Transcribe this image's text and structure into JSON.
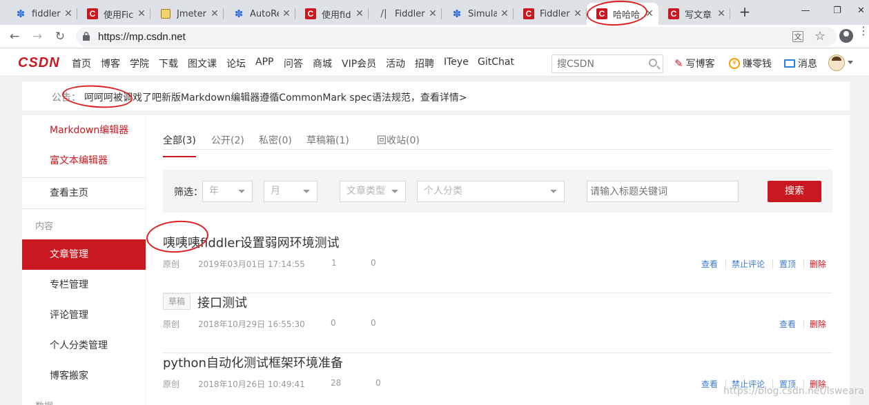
{
  "browser": {
    "tabs": [
      {
        "title": "fiddler",
        "icon": "paw-icon"
      },
      {
        "title": "使用Fic",
        "icon": "csdn-icon"
      },
      {
        "title": "Jmeter",
        "icon": "notepad-icon"
      },
      {
        "title": "AutoRe",
        "icon": "paw-icon"
      },
      {
        "title": "使用fid",
        "icon": "csdn-icon"
      },
      {
        "title": "Fiddler",
        "icon": "fiddler-icon"
      },
      {
        "title": "Simulat",
        "icon": "paw-icon"
      },
      {
        "title": "Fiddler",
        "icon": "csdn-icon"
      },
      {
        "title": "哈哈哈",
        "icon": "csdn-icon"
      },
      {
        "title": "写文章",
        "icon": "csdn-icon"
      }
    ],
    "active_tab": 8,
    "url": "https://mp.csdn.net"
  },
  "csdn": {
    "logo": "CSDN",
    "nav": [
      "首页",
      "博客",
      "学院",
      "下载",
      "图文课",
      "论坛",
      "APP",
      "问答",
      "商城",
      "VIP会员",
      "活动",
      "招聘",
      "ITeye",
      "GitChat"
    ],
    "search_placeholder": "搜CSDN",
    "write_label": "写博客",
    "earn_label": "赚零钱",
    "message_label": "消息"
  },
  "notice": {
    "label": "公告：",
    "text": "呵呵呵被调戏了吧新版Markdown编辑器遵循CommonMark spec语法规范，查看详情>"
  },
  "sidebar": {
    "editors": [
      "Markdown编辑器",
      "富文本编辑器"
    ],
    "home": "查看主页",
    "group_content": "内容",
    "items": [
      "文章管理",
      "专栏管理",
      "评论管理",
      "个人分类管理",
      "博客搬家"
    ],
    "group_data": "数据"
  },
  "main": {
    "tabs": [
      "全部(3)",
      "公开(2)",
      "私密(0)",
      "草稿箱(1)",
      "回收站(0)"
    ],
    "filter": {
      "label": "筛选：",
      "year": "年",
      "month": "月",
      "type": "文章类型",
      "category": "个人分类",
      "keyword_placeholder": "请输入标题关键词",
      "search_button": "搜索"
    },
    "articles": [
      {
        "title": "咦咦咦fiddler设置弱网环境测试",
        "badge": "",
        "type": "原创",
        "date": "2019年03月01日 17:14:55",
        "views": "1",
        "comments": "0",
        "actions": [
          "查看",
          "禁止评论",
          "置顶",
          "删除"
        ]
      },
      {
        "title": "接口测试",
        "badge": "草稿",
        "type": "原创",
        "date": "2018年10月29日 16:55:30",
        "views": "0",
        "comments": "0",
        "actions": [
          "查看",
          "删除"
        ]
      },
      {
        "title": "python自动化测试框架环境准备",
        "badge": "",
        "type": "原创",
        "date": "2018年10月26日 10:49:41",
        "views": "28",
        "comments": "0",
        "actions": [
          "查看",
          "禁止评论",
          "置顶",
          "删除"
        ]
      }
    ]
  },
  "watermark": "https://blog.csdn.net/lsweara",
  "colors": {
    "brand": "#c9181f",
    "link": "#3e7bd4",
    "annotation": "#e01f1f"
  }
}
